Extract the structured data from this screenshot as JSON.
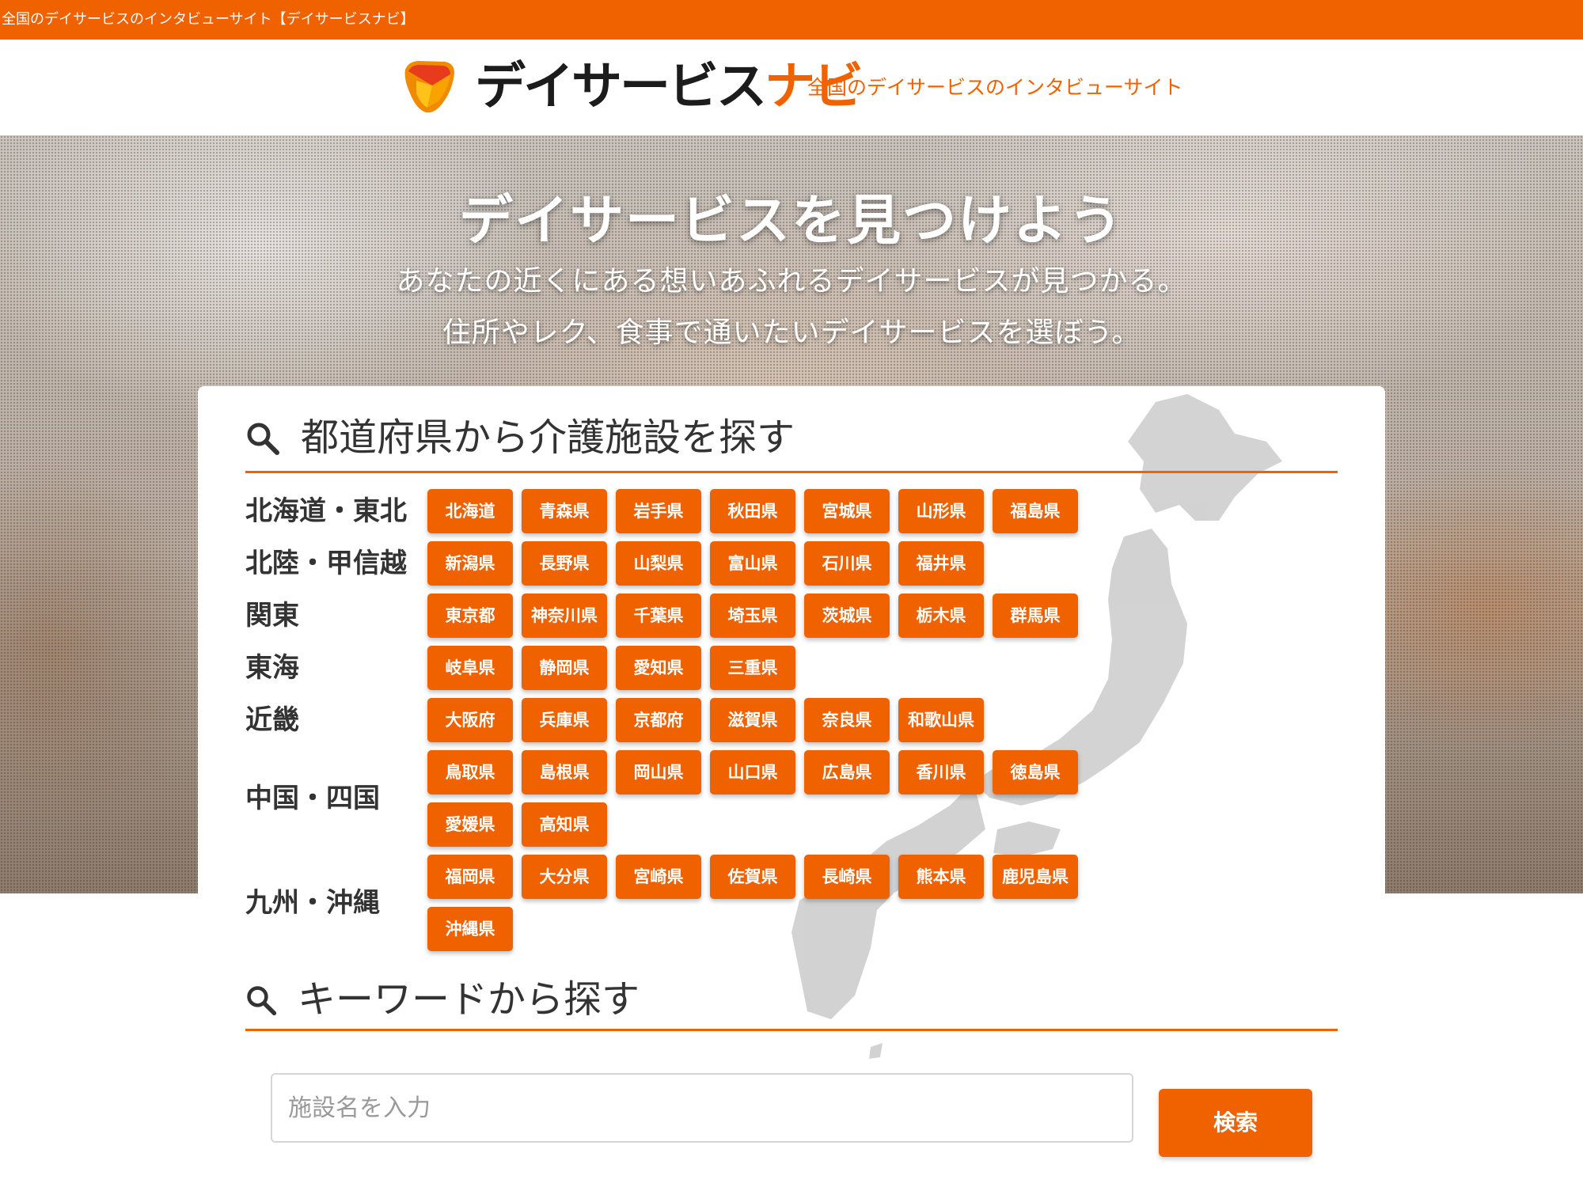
{
  "topbar": {
    "text": "全国のデイサービスのインタビューサイト【デイサービスナビ】"
  },
  "header": {
    "logo_text_main": "デイサービス",
    "logo_text_accent": "ナビ",
    "tagline": "全国のデイサービスのインタビューサイト"
  },
  "hero": {
    "title": "デイサービスを見つけよう",
    "subtitle_line1": "あなたの近くにある想いあふれるデイサービスが見つかる。",
    "subtitle_line2": "住所やレク、食事で通いたいデイサービスを選ぼう。"
  },
  "prefecture_search": {
    "heading": "都道府県から介護施設を探す",
    "icon": "search-icon",
    "regions": [
      {
        "label": "北海道・東北",
        "rows": [
          [
            "北海道",
            "青森県",
            "岩手県",
            "秋田県",
            "宮城県",
            "山形県",
            "福島県"
          ]
        ]
      },
      {
        "label": "北陸・甲信越",
        "rows": [
          [
            "新潟県",
            "長野県",
            "山梨県",
            "富山県",
            "石川県",
            "福井県"
          ]
        ]
      },
      {
        "label": "関東",
        "rows": [
          [
            "東京都",
            "神奈川県",
            "千葉県",
            "埼玉県",
            "茨城県",
            "栃木県",
            "群馬県"
          ]
        ]
      },
      {
        "label": "東海",
        "rows": [
          [
            "岐阜県",
            "静岡県",
            "愛知県",
            "三重県"
          ]
        ]
      },
      {
        "label": "近畿",
        "rows": [
          [
            "大阪府",
            "兵庫県",
            "京都府",
            "滋賀県",
            "奈良県",
            "和歌山県"
          ]
        ]
      },
      {
        "label": "中国・四国",
        "rows": [
          [
            "鳥取県",
            "島根県",
            "岡山県",
            "山口県",
            "広島県",
            "香川県",
            "徳島県"
          ],
          [
            "愛媛県",
            "高知県"
          ]
        ]
      },
      {
        "label": "九州・沖縄",
        "rows": [
          [
            "福岡県",
            "大分県",
            "宮崎県",
            "佐賀県",
            "長崎県",
            "熊本県",
            "鹿児島県"
          ],
          [
            "沖縄県"
          ]
        ]
      }
    ]
  },
  "keyword_search": {
    "heading": "キーワードから探す",
    "icon": "search-icon",
    "input_placeholder": "施設名を入力",
    "button_label": "検索"
  },
  "colors": {
    "accent": "#f06100",
    "text": "#333333",
    "map": "#c8c8c8"
  }
}
